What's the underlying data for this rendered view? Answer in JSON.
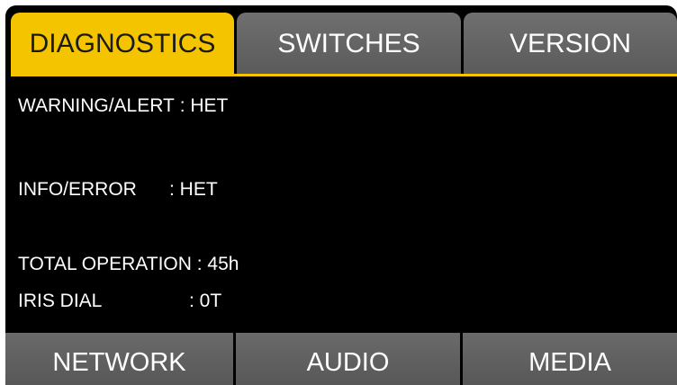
{
  "tabs": [
    {
      "label": "DIAGNOSTICS",
      "active": true
    },
    {
      "label": "SWITCHES",
      "active": false
    },
    {
      "label": "VERSION",
      "active": false
    }
  ],
  "info": {
    "warning_alert": {
      "label": "WARNING/ALERT",
      "value": " : HET"
    },
    "info_error": {
      "label": "INFO/ERROR",
      "value": ": HET"
    },
    "total_operation": {
      "label": "TOTAL OPERATION",
      "value": " : 45h"
    },
    "iris_dial": {
      "label": "IRIS DIAL",
      "value": ": 0T"
    }
  },
  "bottom_buttons": [
    {
      "label": "NETWORK"
    },
    {
      "label": "AUDIO"
    },
    {
      "label": "MEDIA"
    }
  ],
  "colors": {
    "accent": "#f5c400",
    "tab_inactive": "#5f5f5f",
    "background": "#000000",
    "text": "#ffffff"
  }
}
